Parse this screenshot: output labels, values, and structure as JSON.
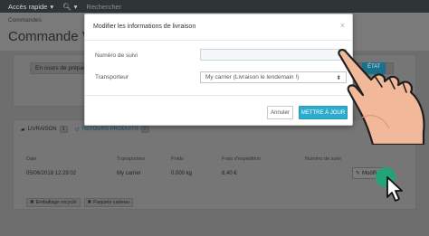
{
  "topbar": {
    "quick_access": "Accès rapide",
    "search_placeholder": "Rechercher"
  },
  "header": {
    "breadcrumb": "Commandes",
    "title": "Commande V"
  },
  "status_panel": {
    "current_status": "En cours de préparation",
    "update_status_button": "ÉTAT"
  },
  "shipping_panel": {
    "tabs": [
      {
        "label": "LIVRAISON",
        "count": "1"
      },
      {
        "label": "RETOURS PRODUITS",
        "count": "0"
      }
    ],
    "columns": [
      "Date",
      "Transporteur",
      "Poids",
      "Frais d'expédition",
      "Numéro de suivi"
    ],
    "rows": [
      {
        "date": "05/06/2018 12:29:02",
        "carrier": "My carrier",
        "weight": "0.000 kg",
        "cost": "8,40 €",
        "tracking": ""
      }
    ],
    "edit_button": "Modifi",
    "checkboxes": [
      "Emballage recyclé",
      "Paquets cadeau"
    ]
  },
  "modal": {
    "title": "Modifier les informations de livraison",
    "close": "×",
    "tracking_label": "Numéro de suivi",
    "tracking_value": "",
    "carrier_label": "Transporteur",
    "carrier_selected": "My carrier (Livraison le lendemain !)",
    "cancel_button": "Annuler",
    "update_button": "METTRE À JOUR"
  },
  "colors": {
    "accent": "#2eacce",
    "cursor_dot": "#1ea57a",
    "hand_skin": "#f2b89a"
  }
}
